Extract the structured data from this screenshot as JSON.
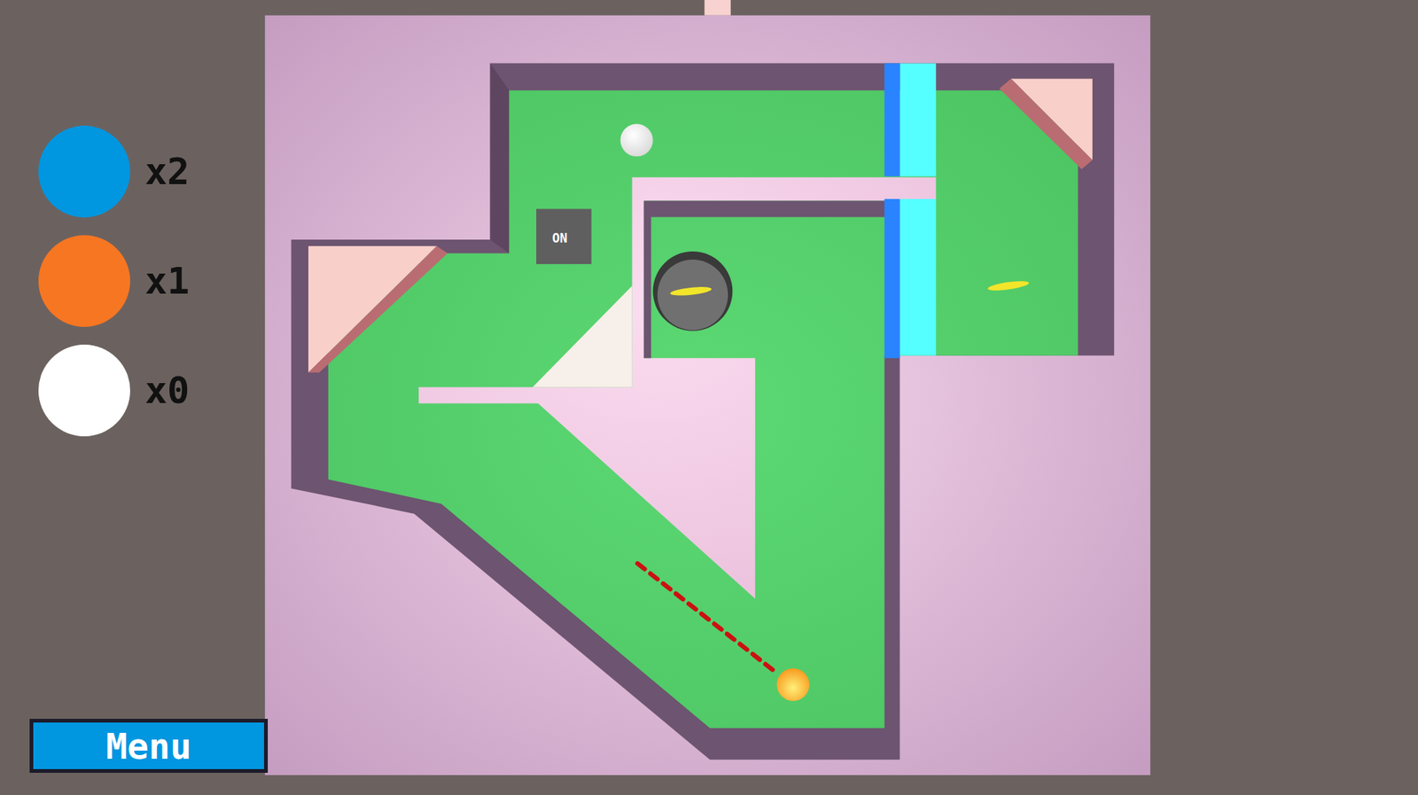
{
  "hud": {
    "balls": [
      {
        "count": "x2",
        "color": "#0096e0"
      },
      {
        "count": "x1",
        "color": "#f77622"
      },
      {
        "count": "x0",
        "color": "#ffffff"
      }
    ]
  },
  "switch": {
    "label": "ON",
    "on": true
  },
  "menu_button": {
    "label": "Menu"
  }
}
